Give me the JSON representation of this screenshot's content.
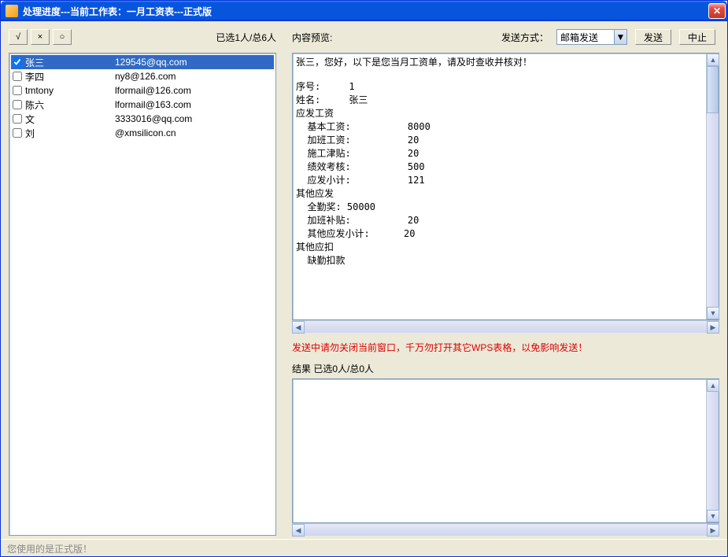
{
  "window": {
    "title": "处理进度---当前工作表：一月工资表---正式版"
  },
  "toolbar": {
    "check_all": "√",
    "uncheck_all": "×",
    "invert": "○",
    "selection_count": "已选1人/总6人"
  },
  "right_header": {
    "preview_label": "内容预览:",
    "send_method_label": "发送方式：",
    "send_method_value": "邮箱发送",
    "send_btn": "发送",
    "stop_btn": "中止"
  },
  "list": [
    {
      "checked": true,
      "name": "张三",
      "email": "129545@qq.com",
      "selected": true
    },
    {
      "checked": false,
      "name": "李四",
      "email": "ny8@126.com",
      "selected": false
    },
    {
      "checked": false,
      "name": "tmtony",
      "email": "lformail@126.com",
      "selected": false
    },
    {
      "checked": false,
      "name": "陈六",
      "email": "lformail@163.com",
      "selected": false
    },
    {
      "checked": false,
      "name": "文",
      "email": "3333016@qq.com",
      "selected": false
    },
    {
      "checked": false,
      "name": "刘",
      "email": "@xmsilicon.cn",
      "selected": false
    }
  ],
  "preview": "张三，您好，以下是您当月工资单，请及时查收并核对！\n\n序号:     1\n姓名:     张三\n应发工资\n  基本工资:          8000\n  加班工资:          20\n  施工津贴:          20\n  绩效考核:          500\n  应发小计:          121\n其他应发\n  全勤奖: 50000\n  加班补贴:          20\n  其他应发小计:      20\n其他应扣\n  缺勤扣款",
  "warning_text": "发送中请勿关闭当前窗口，千万勿打开其它WPS表格，以免影响发送！",
  "result_label": "结果  已选0人/总0人",
  "statusbar_text": "您使用的是正式版！"
}
